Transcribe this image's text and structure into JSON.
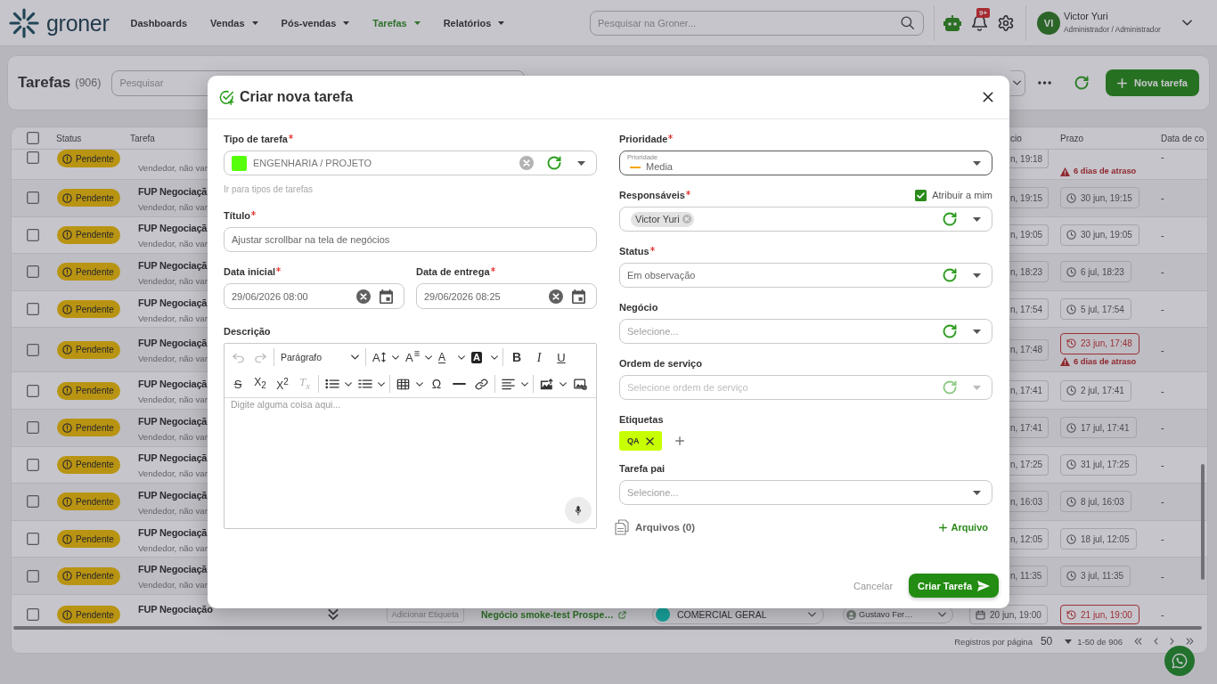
{
  "nav": {
    "logo": "groner",
    "menu": [
      {
        "label": "Dashboards",
        "dropdown": false,
        "selected": false
      },
      {
        "label": "Vendas",
        "dropdown": true,
        "selected": false
      },
      {
        "label": "Pós-vendas",
        "dropdown": true,
        "selected": false
      },
      {
        "label": "Tarefas",
        "dropdown": true,
        "selected": true
      },
      {
        "label": "Relatórios",
        "dropdown": true,
        "selected": false
      }
    ],
    "search": {
      "placeholder": "Pesquisar na Groner..."
    },
    "notification_count": "9+",
    "user": {
      "initials": "VI",
      "name": "Victor Yuri",
      "role": "Administrador / Administrador"
    }
  },
  "toolbar": {
    "title": "Tarefas",
    "count": "(906)",
    "search": {
      "placeholder": "Pesquisar"
    },
    "new_button": "Nova tarefa"
  },
  "table": {
    "select_all": {
      "checked": false
    },
    "columns": [
      "Status",
      "Tarefa",
      "cio",
      "Prazo",
      "Data de co"
    ],
    "rows": [
      {
        "kind": "top_cut",
        "checked": false,
        "status": "Pendente",
        "subtitle": "Vendedor, não var",
        "start": "n, 19:18",
        "deadline": {
          "note": "6 dias de atraso"
        },
        "completed": "-"
      },
      {
        "kind": "clipped",
        "checked": false,
        "status": "Pendente",
        "title": "FUP Negociaçã",
        "subtitle": "Vendedor, não var",
        "start": "n, 19:15",
        "deadline": {
          "date": "30 jun, 19:15",
          "overdue": false
        },
        "completed": "-"
      },
      {
        "kind": "clipped",
        "checked": false,
        "status": "Pendente",
        "title": "FUP Negociaçã",
        "subtitle": "Vendedor, não var",
        "start": "n, 19:05",
        "deadline": {
          "date": "30 jun, 19:05",
          "overdue": false
        },
        "completed": "-"
      },
      {
        "kind": "clipped",
        "checked": false,
        "status": "Pendente",
        "title": "FUP Negociaçã",
        "subtitle": "Vendedor, não var",
        "start": "n, 18:23",
        "deadline": {
          "date": "6 jul, 18:23",
          "overdue": false
        },
        "completed": "-"
      },
      {
        "kind": "clipped",
        "checked": false,
        "status": "Pendente",
        "title": "FUP Negociaçã",
        "subtitle": "Vendedor, não var",
        "start": "n, 17:54",
        "deadline": {
          "date": "5 jul, 17:54",
          "overdue": false
        },
        "completed": "-"
      },
      {
        "kind": "clipped",
        "checked": false,
        "status": "Pendente",
        "title": "FUP Negociaçã",
        "subtitle": "Vendedor, não var",
        "start": "n, 17:48",
        "deadline": {
          "date": "23 jun, 17:48",
          "overdue": true,
          "note": "6 dias de atraso"
        },
        "completed": "-"
      },
      {
        "kind": "clipped",
        "checked": false,
        "status": "Pendente",
        "title": "FUP Negociaçã",
        "subtitle": "Vendedor, não var",
        "start": "n, 17:41",
        "deadline": {
          "date": "2 jul, 17:41",
          "overdue": false
        },
        "completed": "-"
      },
      {
        "kind": "clipped",
        "checked": false,
        "status": "Pendente",
        "title": "FUP Negociaçã",
        "subtitle": "Vendedor, não var",
        "start": "n, 17:41",
        "deadline": {
          "date": "17 jul, 17:41",
          "overdue": false
        },
        "completed": "-"
      },
      {
        "kind": "clipped",
        "checked": false,
        "status": "Pendente",
        "title": "FUP Negociaçã",
        "subtitle": "Vendedor, não var",
        "start": "n, 17:25",
        "deadline": {
          "date": "31 jul, 17:25",
          "overdue": false
        },
        "completed": "-"
      },
      {
        "kind": "clipped",
        "checked": false,
        "status": "Pendente",
        "title": "FUP Negociaçã",
        "subtitle": "Vendedor, não var",
        "start": "n, 16:03",
        "deadline": {
          "date": "8 jul, 16:03",
          "overdue": false
        },
        "completed": "-"
      },
      {
        "kind": "clipped",
        "checked": false,
        "status": "Pendente",
        "title": "FUP Negociaçã",
        "subtitle": "Vendedor, não var",
        "start": "n, 12:05",
        "deadline": {
          "date": "18 jul, 12:05",
          "overdue": false
        },
        "completed": "-"
      },
      {
        "kind": "clipped",
        "checked": false,
        "status": "Pendente",
        "title": "FUP Negociaçã",
        "subtitle": "Vendedor, não var",
        "start": "n, 11:35",
        "deadline": {
          "date": "3 jul, 11:35",
          "overdue": false
        },
        "completed": "-"
      },
      {
        "kind": "full",
        "checked": false,
        "status": "Pendente",
        "title": "FUP Negociação",
        "tags_placeholder": "Adicionar Etiqueta",
        "deal": "Negócio smoke-test Prospe…",
        "type": {
          "label": "COMERCIAL GERAL",
          "color": "#18a39c"
        },
        "assignee": "Gustavo Fer…",
        "start": "20 jun, 19:00",
        "deadline": {
          "date": "21 jun, 19:00",
          "overdue": true
        },
        "completed": "-"
      }
    ],
    "pagination": {
      "rows_per_page_label": "Registros por página",
      "rows_per_page": "50",
      "range": "1-50 de 906"
    }
  },
  "modal": {
    "title": "Criar nova tarefa",
    "left": [
      {
        "kind": "select",
        "label": "Tipo de tarefa",
        "required": true,
        "value": "ENGENHARIA / PROJETO",
        "color": "#55ff0a",
        "clearable": true,
        "refresh": true,
        "help_link": "Ir para tipos de tarefas"
      },
      {
        "kind": "text",
        "label": "Título",
        "required": true,
        "value": "Ajustar scrollbar na tela de negócios"
      },
      {
        "kind": "dates",
        "items": [
          {
            "label": "Data inicial",
            "required": true,
            "value": "29/06/2026 08:00"
          },
          {
            "label": "Data de entrega",
            "required": true,
            "value": "29/06/2026 08:25"
          }
        ]
      },
      {
        "kind": "editor",
        "label": "Descrição",
        "required": false,
        "placeholder": "Digite alguma coisa aqui...",
        "toolbar": [
          [
            {
              "kind": "undo",
              "disabled": true
            },
            {
              "kind": "redo",
              "disabled": true
            },
            {
              "kind": "separator"
            },
            {
              "kind": "format",
              "text": "Parágrafo"
            },
            {
              "kind": "separator"
            },
            {
              "kind": "size",
              "text": "A",
              "dropdown": true,
              "disabled": false
            },
            {
              "kind": "family",
              "text": "A",
              "dropdown": true,
              "disabled": false
            },
            {
              "kind": "color",
              "text": "A",
              "dropdown": true,
              "disabled": false
            },
            {
              "kind": "highlight",
              "text": "A",
              "dropdown": true,
              "disabled": false
            },
            {
              "kind": "separator"
            },
            {
              "kind": "bold",
              "text": "B",
              "disabled": false
            },
            {
              "kind": "italic",
              "text": "I",
              "disabled": false
            },
            {
              "kind": "underline",
              "text": "U",
              "disabled": false
            }
          ],
          [
            {
              "kind": "strike",
              "text": "S",
              "disabled": false
            },
            {
              "kind": "sub",
              "text": "X$_{2}$",
              "disabled": false
            },
            {
              "kind": "sup",
              "text": "X$^{2}$",
              "disabled": false
            },
            {
              "kind": "clear",
              "text": "T$_{x}$",
              "disabled": true
            },
            {
              "kind": "separator"
            },
            {
              "kind": "bullets",
              "dropdown": true,
              "disabled": false
            },
            {
              "kind": "numbers",
              "dropdown": true,
              "disabled": false
            },
            {
              "kind": "separator"
            },
            {
              "kind": "table",
              "dropdown": true,
              "disabled": false
            },
            {
              "kind": "omega",
              "text": "Ω",
              "disabled": false
            },
            {
              "kind": "rule",
              "disabled": false
            },
            {
              "kind": "link",
              "disabled": false
            },
            {
              "kind": "separator"
            },
            {
              "kind": "align",
              "dropdown": true,
              "disabled": false
            },
            {
              "kind": "separator"
            },
            {
              "kind": "image_upload",
              "dropdown": true,
              "disabled": false
            },
            {
              "kind": "image",
              "disabled": false
            }
          ]
        ]
      }
    ],
    "right": [
      {
        "kind": "priority",
        "label": "Prioridade",
        "required": true,
        "inner_label": "Prioridade",
        "value": "Media",
        "color": "#f5a800",
        "focused": true
      },
      {
        "kind": "select",
        "label": "Responsáveis",
        "required": true,
        "chips": [
          "Victor Yuri"
        ],
        "refresh": true,
        "assign_me": {
          "label": "Atribuir a mim",
          "checked": true
        }
      },
      {
        "kind": "select",
        "label": "Status",
        "required": true,
        "value": "Em observação",
        "refresh": true
      },
      {
        "kind": "select",
        "label": "Negócio",
        "required": false,
        "placeholder": "Selecione...",
        "refresh": true
      },
      {
        "kind": "select",
        "label": "Ordem de serviço",
        "required": false,
        "placeholder": "Selecione ordem de serviço",
        "refresh": true,
        "disabled": true
      },
      {
        "kind": "tags",
        "label": "Etiquetas",
        "tags": [
          {
            "label": "QA",
            "color": "#c8ff00"
          }
        ]
      },
      {
        "kind": "select",
        "label": "Tarefa pai",
        "required": false,
        "placeholder": "Selecione...",
        "refresh": false
      }
    ],
    "files": {
      "label": "Arquivos (0)",
      "add": "Arquivo"
    },
    "cancel": "Cancelar",
    "submit": "Criar Tarefa"
  }
}
